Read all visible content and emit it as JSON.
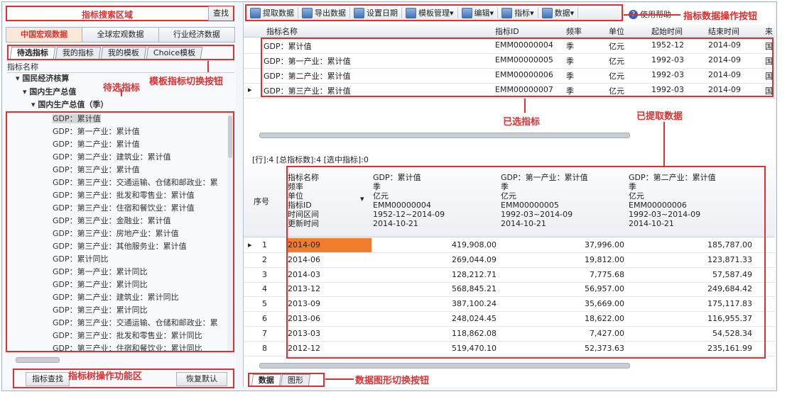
{
  "search": {
    "label": "指标搜索区域",
    "button": "查找"
  },
  "category_tabs": [
    "中国宏观数据",
    "全球宏观数据",
    "行业经济数据"
  ],
  "sub_tabs": [
    "待选指标",
    "我的指标",
    "我的模板",
    "Choice模板"
  ],
  "tree": {
    "header": "指标名称",
    "nodes": [
      "国民经济核算",
      "国内生产总值",
      "国内生产总值（季）"
    ],
    "leaves": [
      "GDP：累计值",
      "GDP：第一产业：累计值",
      "GDP：第二产业：累计值",
      "GDP：第二产业：建筑业：累计值",
      "GDP：第三产业：累计值",
      "GDP：第三产业：交通运输、仓储和邮政业：累",
      "GDP：第三产业：批发和零售业：累计值",
      "GDP：第三产业：住宿和餐饮业：累计值",
      "GDP：第三产业：金融业：累计值",
      "GDP：第三产业：房地产业：累计值",
      "GDP：第三产业：其他服务业：累计值",
      "GDP：累计同比",
      "GDP：第一产业：累计同比",
      "GDP：第二产业：累计同比",
      "GDP：第二产业：建筑业：累计同比",
      "GDP：第三产业：累计同比",
      "GDP：第三产业：交通运输、仓储和邮政业：累",
      "GDP：第三产业：批发和零售业：累计同比",
      "GDP：第三产业：住宿和餐饮业：累计同比"
    ]
  },
  "bottom_buttons": {
    "find": "指标查找",
    "reset": "恢复默认"
  },
  "annotations": {
    "candidate": "待选指标",
    "template_switch": "模板指标切换按钮",
    "tree_ops": "指标树操作功能区",
    "data_ops": "指标数据操作按钮",
    "selected": "已选指标",
    "extracted": "已提取数据",
    "view_switch": "数据图形切换按钮"
  },
  "toolbar": [
    "提取数据",
    "导出数据",
    "设置日期",
    "模板管理",
    "编辑",
    "指标",
    "数据"
  ],
  "toolbar_help": "使用帮助",
  "selected_table": {
    "columns": [
      "指标名称",
      "指标ID",
      "频率",
      "单位",
      "起始时间",
      "结束时间",
      "来"
    ],
    "rows": [
      [
        "GDP：累计值",
        "EMM00000004",
        "季",
        "亿元",
        "1952-12",
        "2014-09",
        "国"
      ],
      [
        "GDP：第一产业：累计值",
        "EMM00000005",
        "季",
        "亿元",
        "1992-03",
        "2014-09",
        "国"
      ],
      [
        "GDP：第二产业：累计值",
        "EMM00000006",
        "季",
        "亿元",
        "1992-03",
        "2014-09",
        "国"
      ],
      [
        "GDP：第三产业：累计值",
        "EMM00000007",
        "季",
        "亿元",
        "1992-03",
        "2014-09",
        "国"
      ]
    ]
  },
  "info_line": "[行]:4  [总指标数]:4  [选中指标]:0",
  "data_table": {
    "seq_header": "序号",
    "meta_header": [
      "指标名称",
      "频率",
      "单位",
      "指标ID",
      "时间区间",
      "更新时间"
    ],
    "columns": [
      [
        "GDP：累计值",
        "季",
        "亿元",
        "EMM00000004",
        "1952-12~2014-09",
        "2014-10-21"
      ],
      [
        "GDP：第一产业：累计值",
        "季",
        "亿元",
        "EMM00000005",
        "1992-03~2014-09",
        "2014-10-21"
      ],
      [
        "GDP：第二产业：累计值",
        "季",
        "亿元",
        "EMM00000006",
        "1992-03~2014-09",
        "2014-10-21"
      ]
    ],
    "rows": [
      [
        "1",
        "2014-09",
        "419,908.00",
        "37,996.00",
        "185,787.00"
      ],
      [
        "2",
        "2014-06",
        "269,044.09",
        "19,812.00",
        "123,871.33"
      ],
      [
        "3",
        "2014-03",
        "128,212.71",
        "7,775.68",
        "57,587.49"
      ],
      [
        "4",
        "2013-12",
        "568,845.21",
        "56,957.00",
        "249,684.42"
      ],
      [
        "5",
        "2013-09",
        "387,100.24",
        "35,669.00",
        "175,117.83"
      ],
      [
        "6",
        "2013-06",
        "248,024.45",
        "18,622.00",
        "116,955.37"
      ],
      [
        "7",
        "2013-03",
        "118,862.08",
        "7,427.00",
        "54,528.34"
      ],
      [
        "8",
        "2012-12",
        "519,470.10",
        "52,373.63",
        "235,161.99"
      ]
    ]
  },
  "view_tabs": [
    "数据",
    "图形"
  ]
}
